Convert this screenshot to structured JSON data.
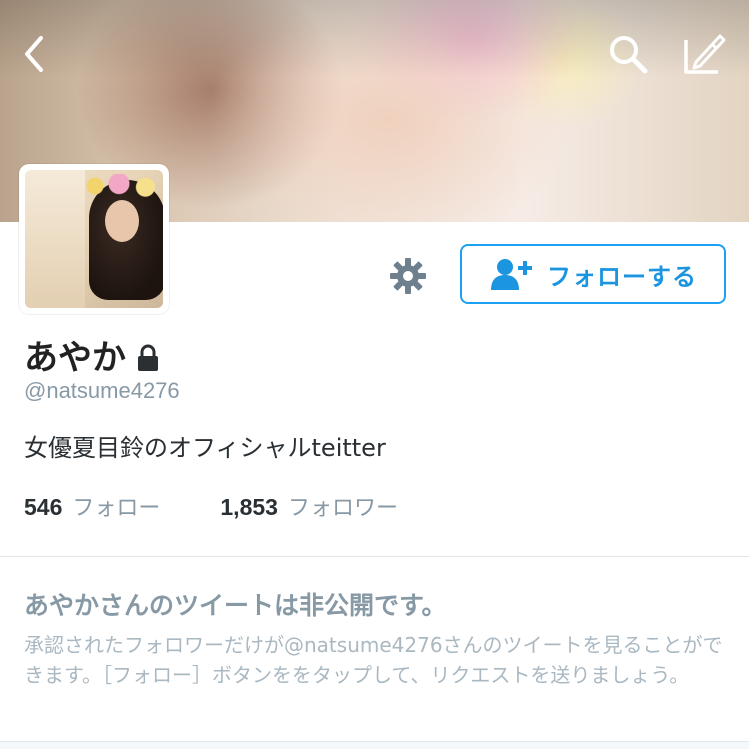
{
  "header": {
    "back_icon": "chevron-left-icon",
    "search_icon": "search-icon",
    "compose_icon": "compose-icon"
  },
  "profile": {
    "name": "あやか",
    "protected_icon": "lock-icon",
    "handle": "@natsume4276",
    "bio": "女優夏目鈴のオフィシャルteitter"
  },
  "actions": {
    "settings_icon": "gear-icon",
    "follow_icon": "add-user-icon",
    "follow_label": "フォローする",
    "accent_color": "#1da1f2"
  },
  "stats": [
    {
      "count": "546",
      "label": "フォロー"
    },
    {
      "count": "1,853",
      "label": "フォロワー"
    }
  ],
  "protected_notice": {
    "title": "あやかさんのツイートは非公開です。",
    "body": "承認されたフォロワーだけが@natsume4276さんのツイートを見ることができます。［フォロー］ボタンををタップして、リクエストを送りましょう。"
  }
}
